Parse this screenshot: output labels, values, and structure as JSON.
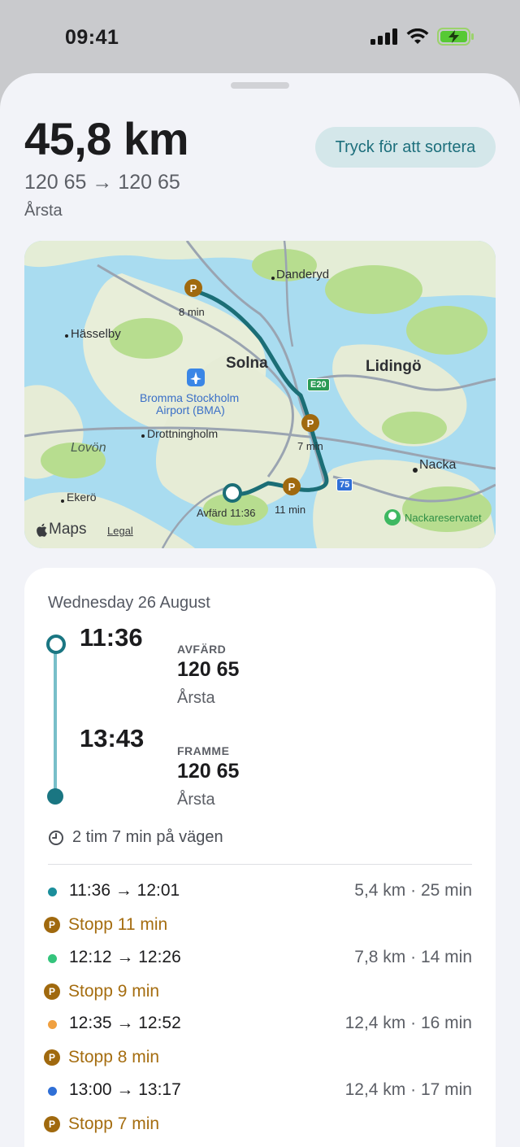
{
  "status": {
    "time": "09:41"
  },
  "header": {
    "distance": "45,8 km",
    "sort_label": "Tryck för att sortera",
    "route": "120 65 → 120 65",
    "place": "Årsta"
  },
  "map": {
    "labels": {
      "danderyd": "Danderyd",
      "hasselby": "Hässelby",
      "solna": "Solna",
      "lidingo": "Lidingö",
      "bromma": "Bromma Stockholm",
      "bromma2": "Airport (BMA)",
      "drottningholm": "Drottningholm",
      "lovon": "Lovön",
      "nacka": "Nacka",
      "ekero": "Ekerö",
      "nackareservatet": "Nackareservatet",
      "e20": "E20",
      "r75": "75"
    },
    "stops": {
      "s1": "8 min",
      "s2": "7 min",
      "s3": "11 min"
    },
    "start_label": "Avfärd 11:36",
    "attribution": "Maps",
    "legal": "Legal"
  },
  "trip": {
    "date": "Wednesday 26 August",
    "depart": {
      "time": "11:36",
      "label": "AVFÄRD",
      "code": "120 65",
      "place": "Årsta"
    },
    "arrive": {
      "time": "13:43",
      "label": "FRAMME",
      "code": "120 65",
      "place": "Årsta"
    },
    "duration": "2 tim 7 min på vägen",
    "segments": [
      {
        "time": "11:36 → 12:01",
        "info": "5,4 km · 25 min",
        "color": "#1a8e9b"
      },
      {
        "time": "12:12 → 12:26",
        "info": "7,8 km · 14 min",
        "color": "#34c47c"
      },
      {
        "time": "12:35 → 12:52",
        "info": "12,4 km · 16 min",
        "color": "#f0a040"
      },
      {
        "time": "13:00 → 13:17",
        "info": "12,4 km · 17 min",
        "color": "#2f6fd6"
      }
    ],
    "stops": [
      "Stopp 11 min",
      "Stopp 9 min",
      "Stopp 8 min",
      "Stopp 7 min"
    ]
  }
}
